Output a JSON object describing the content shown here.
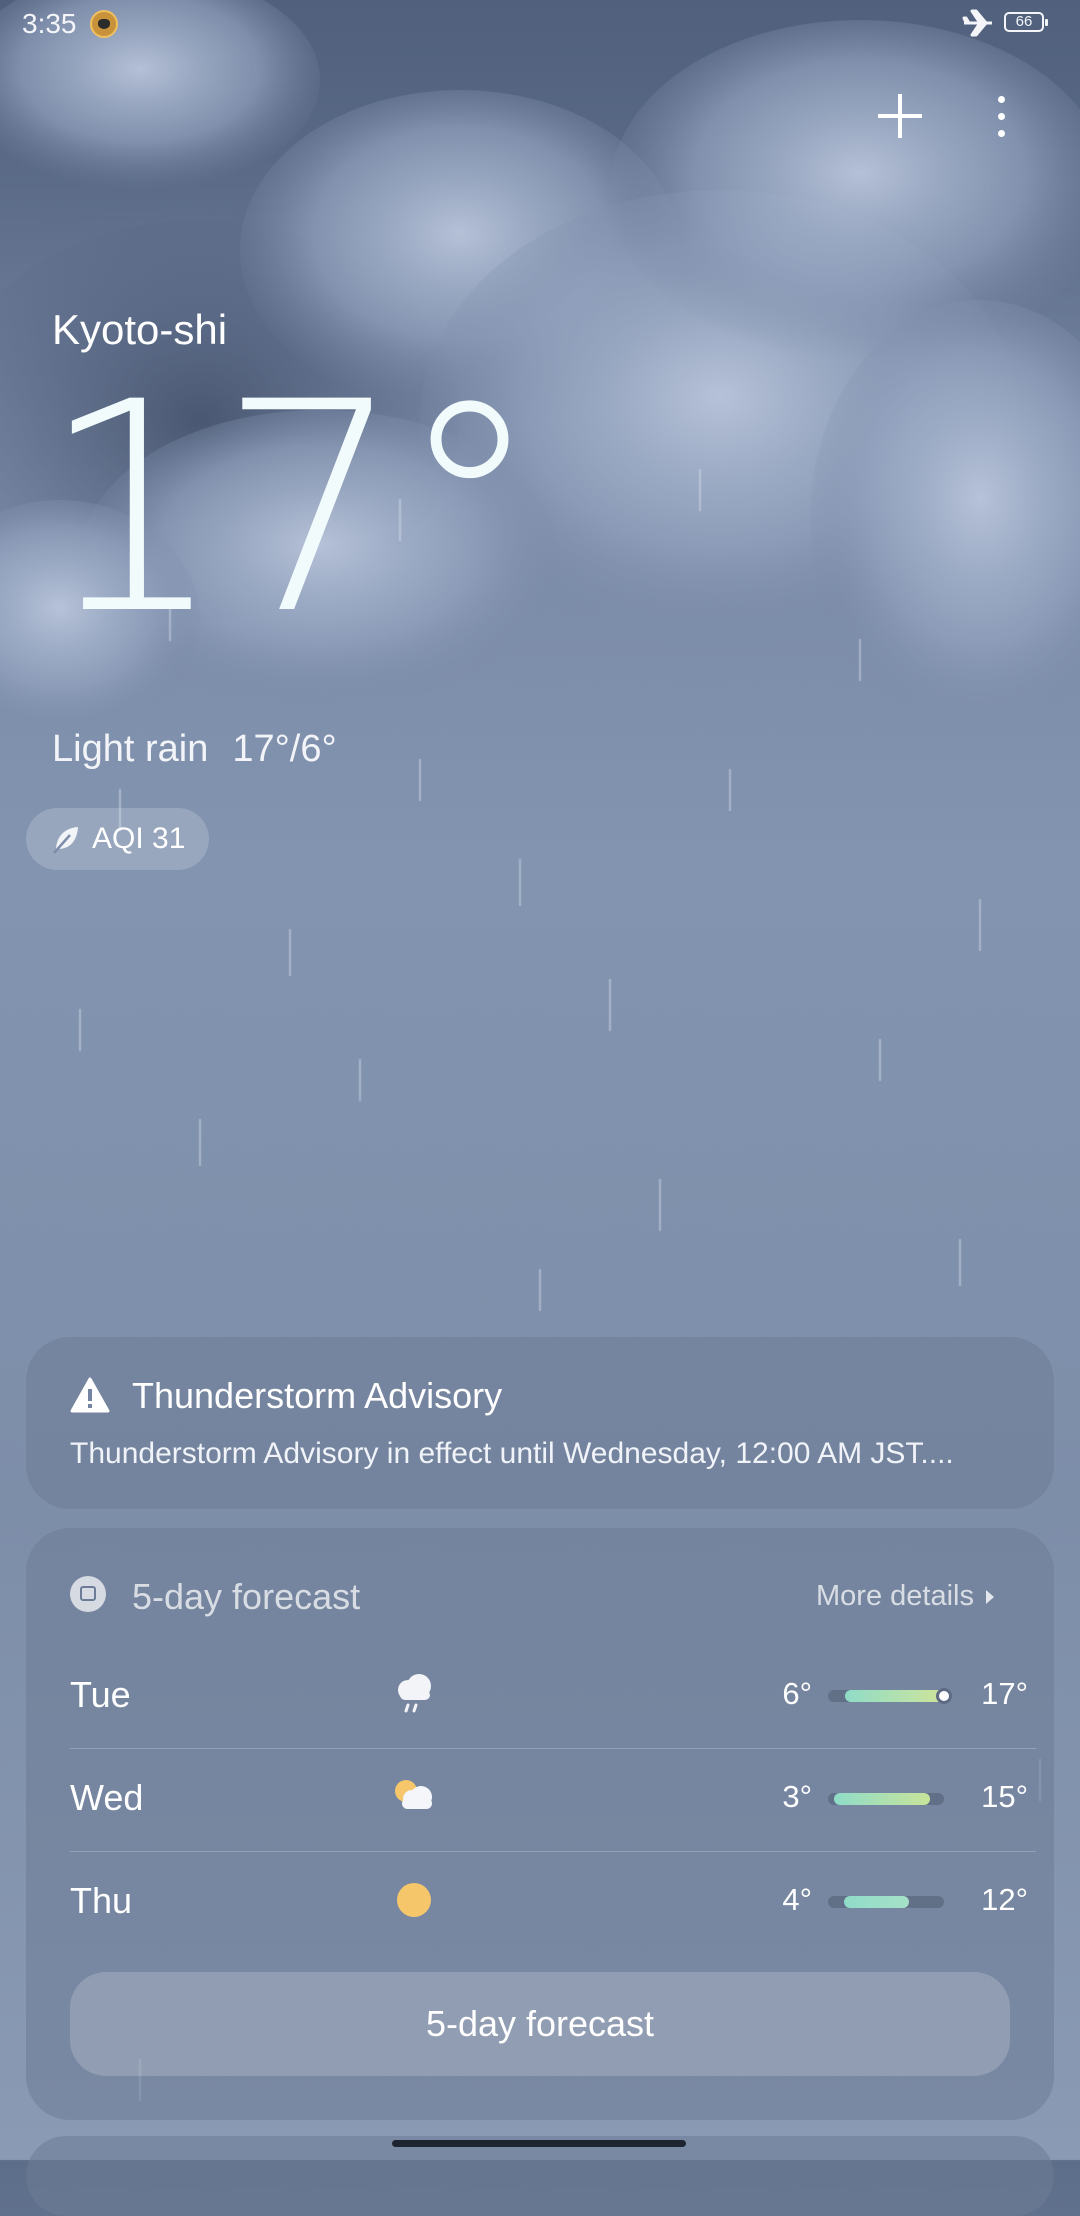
{
  "status_bar": {
    "time": "3:35",
    "battery": "66"
  },
  "location": {
    "city": "Kyoto-shi"
  },
  "current": {
    "temperature": "17°",
    "condition": "Light rain",
    "high_low": "17°/6°",
    "aqi_label": "AQI 31"
  },
  "alert": {
    "title": "Thunderstorm Advisory",
    "body": "Thunderstorm Advisory in effect until Wednesday, 12:00 AM JST...."
  },
  "forecast": {
    "title": "5-day forecast",
    "more_details": "More details",
    "button_label": "5-day forecast",
    "days": [
      {
        "day": "Tue",
        "icon": "rain-cloud-icon",
        "low": "6°",
        "high": "17°",
        "bar_start": 0.15,
        "bar_end": 1.0,
        "bar_color": "#cfe49a",
        "marker": true
      },
      {
        "day": "Wed",
        "icon": "partly-cloudy-icon",
        "low": "3°",
        "high": "15°",
        "bar_start": 0.05,
        "bar_end": 0.88,
        "bar_color": "#c8e49a",
        "marker": false
      },
      {
        "day": "Thu",
        "icon": "sun-icon",
        "low": "4°",
        "high": "12°",
        "bar_start": 0.14,
        "bar_end": 0.7,
        "bar_color": "#a6e0c8",
        "marker": false
      }
    ]
  },
  "colors": {
    "sun": "#f6c66a",
    "bar_teal": "#8fdcc8",
    "bar_yellow": "#e2e68e"
  }
}
